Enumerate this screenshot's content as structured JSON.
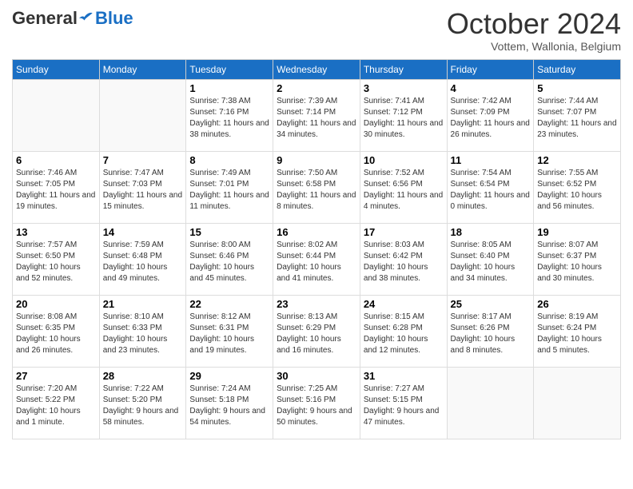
{
  "header": {
    "logo_general": "General",
    "logo_blue": "Blue",
    "month_title": "October 2024",
    "location": "Vottem, Wallonia, Belgium"
  },
  "weekdays": [
    "Sunday",
    "Monday",
    "Tuesday",
    "Wednesday",
    "Thursday",
    "Friday",
    "Saturday"
  ],
  "weeks": [
    [
      {
        "day": "",
        "info": ""
      },
      {
        "day": "",
        "info": ""
      },
      {
        "day": "1",
        "info": "Sunrise: 7:38 AM\nSunset: 7:16 PM\nDaylight: 11 hours and 38 minutes."
      },
      {
        "day": "2",
        "info": "Sunrise: 7:39 AM\nSunset: 7:14 PM\nDaylight: 11 hours and 34 minutes."
      },
      {
        "day": "3",
        "info": "Sunrise: 7:41 AM\nSunset: 7:12 PM\nDaylight: 11 hours and 30 minutes."
      },
      {
        "day": "4",
        "info": "Sunrise: 7:42 AM\nSunset: 7:09 PM\nDaylight: 11 hours and 26 minutes."
      },
      {
        "day": "5",
        "info": "Sunrise: 7:44 AM\nSunset: 7:07 PM\nDaylight: 11 hours and 23 minutes."
      }
    ],
    [
      {
        "day": "6",
        "info": "Sunrise: 7:46 AM\nSunset: 7:05 PM\nDaylight: 11 hours and 19 minutes."
      },
      {
        "day": "7",
        "info": "Sunrise: 7:47 AM\nSunset: 7:03 PM\nDaylight: 11 hours and 15 minutes."
      },
      {
        "day": "8",
        "info": "Sunrise: 7:49 AM\nSunset: 7:01 PM\nDaylight: 11 hours and 11 minutes."
      },
      {
        "day": "9",
        "info": "Sunrise: 7:50 AM\nSunset: 6:58 PM\nDaylight: 11 hours and 8 minutes."
      },
      {
        "day": "10",
        "info": "Sunrise: 7:52 AM\nSunset: 6:56 PM\nDaylight: 11 hours and 4 minutes."
      },
      {
        "day": "11",
        "info": "Sunrise: 7:54 AM\nSunset: 6:54 PM\nDaylight: 11 hours and 0 minutes."
      },
      {
        "day": "12",
        "info": "Sunrise: 7:55 AM\nSunset: 6:52 PM\nDaylight: 10 hours and 56 minutes."
      }
    ],
    [
      {
        "day": "13",
        "info": "Sunrise: 7:57 AM\nSunset: 6:50 PM\nDaylight: 10 hours and 52 minutes."
      },
      {
        "day": "14",
        "info": "Sunrise: 7:59 AM\nSunset: 6:48 PM\nDaylight: 10 hours and 49 minutes."
      },
      {
        "day": "15",
        "info": "Sunrise: 8:00 AM\nSunset: 6:46 PM\nDaylight: 10 hours and 45 minutes."
      },
      {
        "day": "16",
        "info": "Sunrise: 8:02 AM\nSunset: 6:44 PM\nDaylight: 10 hours and 41 minutes."
      },
      {
        "day": "17",
        "info": "Sunrise: 8:03 AM\nSunset: 6:42 PM\nDaylight: 10 hours and 38 minutes."
      },
      {
        "day": "18",
        "info": "Sunrise: 8:05 AM\nSunset: 6:40 PM\nDaylight: 10 hours and 34 minutes."
      },
      {
        "day": "19",
        "info": "Sunrise: 8:07 AM\nSunset: 6:37 PM\nDaylight: 10 hours and 30 minutes."
      }
    ],
    [
      {
        "day": "20",
        "info": "Sunrise: 8:08 AM\nSunset: 6:35 PM\nDaylight: 10 hours and 26 minutes."
      },
      {
        "day": "21",
        "info": "Sunrise: 8:10 AM\nSunset: 6:33 PM\nDaylight: 10 hours and 23 minutes."
      },
      {
        "day": "22",
        "info": "Sunrise: 8:12 AM\nSunset: 6:31 PM\nDaylight: 10 hours and 19 minutes."
      },
      {
        "day": "23",
        "info": "Sunrise: 8:13 AM\nSunset: 6:29 PM\nDaylight: 10 hours and 16 minutes."
      },
      {
        "day": "24",
        "info": "Sunrise: 8:15 AM\nSunset: 6:28 PM\nDaylight: 10 hours and 12 minutes."
      },
      {
        "day": "25",
        "info": "Sunrise: 8:17 AM\nSunset: 6:26 PM\nDaylight: 10 hours and 8 minutes."
      },
      {
        "day": "26",
        "info": "Sunrise: 8:19 AM\nSunset: 6:24 PM\nDaylight: 10 hours and 5 minutes."
      }
    ],
    [
      {
        "day": "27",
        "info": "Sunrise: 7:20 AM\nSunset: 5:22 PM\nDaylight: 10 hours and 1 minute."
      },
      {
        "day": "28",
        "info": "Sunrise: 7:22 AM\nSunset: 5:20 PM\nDaylight: 9 hours and 58 minutes."
      },
      {
        "day": "29",
        "info": "Sunrise: 7:24 AM\nSunset: 5:18 PM\nDaylight: 9 hours and 54 minutes."
      },
      {
        "day": "30",
        "info": "Sunrise: 7:25 AM\nSunset: 5:16 PM\nDaylight: 9 hours and 50 minutes."
      },
      {
        "day": "31",
        "info": "Sunrise: 7:27 AM\nSunset: 5:15 PM\nDaylight: 9 hours and 47 minutes."
      },
      {
        "day": "",
        "info": ""
      },
      {
        "day": "",
        "info": ""
      }
    ]
  ]
}
